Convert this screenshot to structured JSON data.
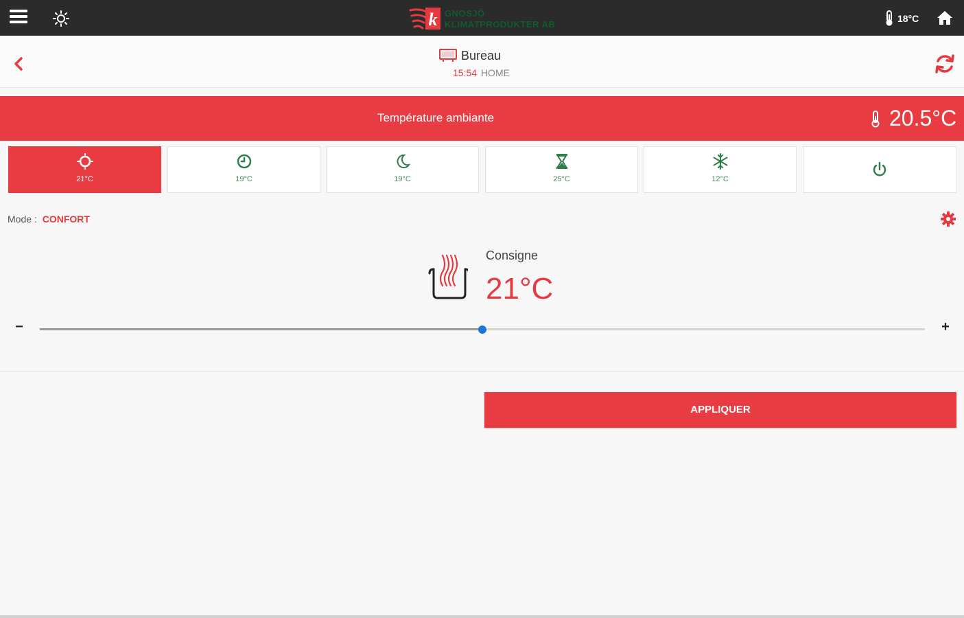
{
  "topbar": {
    "logo_text_line1": "GNOSJÖ",
    "logo_text_line2": "KLIMATPRODUKTER AB",
    "outdoor_temp": "18°C"
  },
  "header": {
    "device_name": "Bureau",
    "time": "15:54",
    "mode": "HOME"
  },
  "ambient": {
    "label": "Température ambiante",
    "value": "20.5°C"
  },
  "modes": [
    {
      "icon": "sun-icon",
      "temp": "21°C",
      "active": true
    },
    {
      "icon": "clock-icon",
      "temp": "19°C",
      "active": false
    },
    {
      "icon": "moon-icon",
      "temp": "19°C",
      "active": false
    },
    {
      "icon": "hourglass-icon",
      "temp": "25°C",
      "active": false
    },
    {
      "icon": "snowflake-icon",
      "temp": "12°C",
      "active": false
    },
    {
      "icon": "power-icon",
      "temp": "",
      "active": false
    }
  ],
  "mode_line": {
    "label": "Mode :",
    "value": "CONFORT"
  },
  "setpoint": {
    "label": "Consigne",
    "value": "21°C",
    "slider_fraction": 0.5
  },
  "controls": {
    "minus": "−",
    "plus": "+",
    "apply": "APPLIQUER"
  },
  "colors": {
    "accent": "#e83c42",
    "icon_green": "#2e7d4a",
    "slider_thumb": "#1e77d4",
    "topbar": "#2b2b2b"
  }
}
